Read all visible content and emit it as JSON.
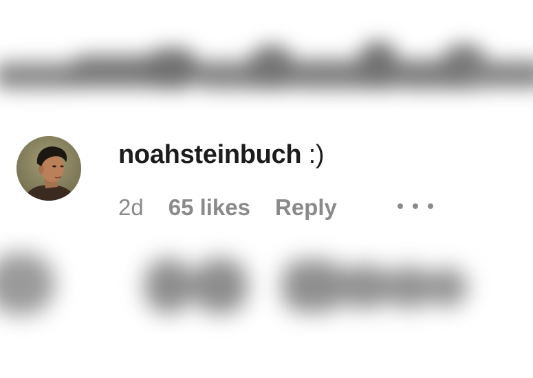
{
  "comment": {
    "username": "noahsteinbuch",
    "text": ":)",
    "time": "2d",
    "likes": "65 likes",
    "reply_label": "Reply"
  },
  "icons": {
    "more": "more-options-icon",
    "avatar": "user-avatar"
  },
  "colors": {
    "text_primary": "#1c1c1c",
    "text_secondary": "#8a8a8a",
    "background": "#ffffff"
  }
}
